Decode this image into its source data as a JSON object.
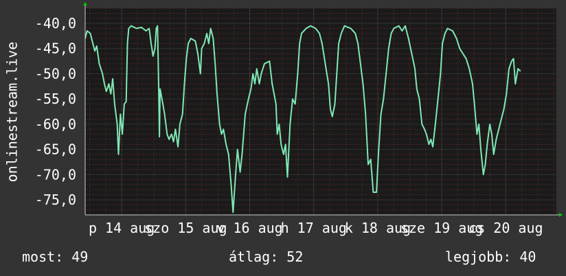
{
  "colors": {
    "background": "#333333",
    "plot_background": "#1a1a1a",
    "grid_major": "#4a4a4a",
    "grid_minor": "#6b2a2a",
    "line": "#7fe8b4",
    "axis_arrow": "#00cc00",
    "text": "#ffffff"
  },
  "chart_data": {
    "type": "line",
    "ylabel": "onlinestream.live",
    "ylim": [
      -78,
      -37
    ],
    "yticks": [
      {
        "value": -40,
        "label": "-40,0"
      },
      {
        "value": -45,
        "label": "-45,0"
      },
      {
        "value": -50,
        "label": "-50,0"
      },
      {
        "value": -55,
        "label": "-55,0"
      },
      {
        "value": -60,
        "label": "-60,0"
      },
      {
        "value": -65,
        "label": "-65,0"
      },
      {
        "value": -70,
        "label": "-70,0"
      },
      {
        "value": -75,
        "label": "-75,0"
      }
    ],
    "xlim": [
      0,
      7.36
    ],
    "xticks": [
      {
        "value": 0.57,
        "label": "p 14 aug"
      },
      {
        "value": 1.57,
        "label": "szo 15 aug"
      },
      {
        "value": 2.57,
        "label": "v 16 aug"
      },
      {
        "value": 3.57,
        "label": "h 17 aug"
      },
      {
        "value": 4.57,
        "label": "k 18 aug"
      },
      {
        "value": 5.57,
        "label": "sze 19 aug"
      },
      {
        "value": 6.57,
        "label": "cs 20 aug"
      }
    ],
    "series": [
      {
        "values": [
          [
            0.0,
            -43
          ],
          [
            0.03,
            -41.5
          ],
          [
            0.08,
            -42
          ],
          [
            0.12,
            -44
          ],
          [
            0.15,
            -45.5
          ],
          [
            0.18,
            -44.5
          ],
          [
            0.22,
            -48
          ],
          [
            0.27,
            -50
          ],
          [
            0.3,
            -52
          ],
          [
            0.33,
            -53.5
          ],
          [
            0.37,
            -52
          ],
          [
            0.4,
            -54
          ],
          [
            0.43,
            -51
          ],
          [
            0.46,
            -56
          ],
          [
            0.5,
            -60
          ],
          [
            0.52,
            -66
          ],
          [
            0.55,
            -58
          ],
          [
            0.58,
            -62
          ],
          [
            0.61,
            -56
          ],
          [
            0.64,
            -55.5
          ],
          [
            0.66,
            -44
          ],
          [
            0.68,
            -41
          ],
          [
            0.72,
            -40.5
          ],
          [
            0.8,
            -41
          ],
          [
            0.88,
            -40.8
          ],
          [
            0.95,
            -41.5
          ],
          [
            1.0,
            -41
          ],
          [
            1.03,
            -44
          ],
          [
            1.06,
            -46.5
          ],
          [
            1.09,
            -45
          ],
          [
            1.11,
            -41
          ],
          [
            1.13,
            -40.5
          ],
          [
            1.15,
            -54
          ],
          [
            1.16,
            -62.5
          ],
          [
            1.17,
            -53
          ],
          [
            1.2,
            -55
          ],
          [
            1.24,
            -58
          ],
          [
            1.28,
            -62
          ],
          [
            1.31,
            -63
          ],
          [
            1.35,
            -62
          ],
          [
            1.38,
            -63.5
          ],
          [
            1.41,
            -61
          ],
          [
            1.45,
            -64.5
          ],
          [
            1.48,
            -60
          ],
          [
            1.52,
            -58
          ],
          [
            1.55,
            -52
          ],
          [
            1.58,
            -47
          ],
          [
            1.61,
            -44
          ],
          [
            1.65,
            -43
          ],
          [
            1.72,
            -43.5
          ],
          [
            1.76,
            -46
          ],
          [
            1.8,
            -50
          ],
          [
            1.82,
            -45
          ],
          [
            1.86,
            -44
          ],
          [
            1.9,
            -42
          ],
          [
            1.93,
            -44
          ],
          [
            1.96,
            -41
          ],
          [
            2.0,
            -43
          ],
          [
            2.03,
            -48
          ],
          [
            2.06,
            -54
          ],
          [
            2.1,
            -60
          ],
          [
            2.13,
            -62
          ],
          [
            2.16,
            -61
          ],
          [
            2.2,
            -64
          ],
          [
            2.24,
            -66
          ],
          [
            2.28,
            -72
          ],
          [
            2.31,
            -77.5
          ],
          [
            2.35,
            -70
          ],
          [
            2.38,
            -65
          ],
          [
            2.42,
            -69.5
          ],
          [
            2.45,
            -66
          ],
          [
            2.5,
            -58
          ],
          [
            2.55,
            -55
          ],
          [
            2.59,
            -53
          ],
          [
            2.62,
            -50
          ],
          [
            2.65,
            -52
          ],
          [
            2.68,
            -49
          ],
          [
            2.72,
            -52
          ],
          [
            2.75,
            -50
          ],
          [
            2.8,
            -48
          ],
          [
            2.88,
            -47.5
          ],
          [
            2.92,
            -52
          ],
          [
            2.95,
            -54
          ],
          [
            2.98,
            -56
          ],
          [
            3.0,
            -62
          ],
          [
            3.03,
            -60
          ],
          [
            3.06,
            -64
          ],
          [
            3.1,
            -66
          ],
          [
            3.13,
            -64
          ],
          [
            3.16,
            -70.5
          ],
          [
            3.2,
            -60
          ],
          [
            3.24,
            -55
          ],
          [
            3.28,
            -56
          ],
          [
            3.32,
            -50
          ],
          [
            3.35,
            -44
          ],
          [
            3.38,
            -42
          ],
          [
            3.45,
            -41
          ],
          [
            3.52,
            -40.5
          ],
          [
            3.6,
            -41
          ],
          [
            3.66,
            -42
          ],
          [
            3.7,
            -44
          ],
          [
            3.75,
            -48
          ],
          [
            3.8,
            -52
          ],
          [
            3.83,
            -57
          ],
          [
            3.86,
            -58.5
          ],
          [
            3.9,
            -56
          ],
          [
            3.93,
            -50
          ],
          [
            3.96,
            -44
          ],
          [
            4.0,
            -42
          ],
          [
            4.05,
            -40.5
          ],
          [
            4.15,
            -41
          ],
          [
            4.22,
            -42
          ],
          [
            4.26,
            -44
          ],
          [
            4.3,
            -48
          ],
          [
            4.34,
            -52
          ],
          [
            4.38,
            -58
          ],
          [
            4.42,
            -68
          ],
          [
            4.46,
            -67
          ],
          [
            4.5,
            -73.5
          ],
          [
            4.55,
            -73.5
          ],
          [
            4.58,
            -66
          ],
          [
            4.62,
            -58
          ],
          [
            4.66,
            -55
          ],
          [
            4.7,
            -50
          ],
          [
            4.74,
            -45
          ],
          [
            4.78,
            -42
          ],
          [
            4.82,
            -41
          ],
          [
            4.9,
            -40.5
          ],
          [
            4.95,
            -41.5
          ],
          [
            5.0,
            -40.5
          ],
          [
            5.05,
            -43
          ],
          [
            5.1,
            -46
          ],
          [
            5.15,
            -49
          ],
          [
            5.18,
            -53
          ],
          [
            5.22,
            -55
          ],
          [
            5.26,
            -60
          ],
          [
            5.3,
            -61
          ],
          [
            5.33,
            -62
          ],
          [
            5.37,
            -64
          ],
          [
            5.4,
            -63
          ],
          [
            5.43,
            -64.5
          ],
          [
            5.47,
            -60
          ],
          [
            5.51,
            -55
          ],
          [
            5.55,
            -50
          ],
          [
            5.58,
            -44
          ],
          [
            5.62,
            -42
          ],
          [
            5.66,
            -41
          ],
          [
            5.74,
            -41.5
          ],
          [
            5.8,
            -43
          ],
          [
            5.85,
            -45
          ],
          [
            5.9,
            -46
          ],
          [
            5.95,
            -47
          ],
          [
            6.0,
            -49
          ],
          [
            6.05,
            -52
          ],
          [
            6.08,
            -56
          ],
          [
            6.12,
            -62
          ],
          [
            6.15,
            -60
          ],
          [
            6.18,
            -65
          ],
          [
            6.22,
            -70
          ],
          [
            6.25,
            -68
          ],
          [
            6.28,
            -64
          ],
          [
            6.32,
            -60
          ],
          [
            6.35,
            -62
          ],
          [
            6.38,
            -66
          ],
          [
            6.42,
            -63
          ],
          [
            6.46,
            -61
          ],
          [
            6.5,
            -59
          ],
          [
            6.54,
            -57
          ],
          [
            6.58,
            -54
          ],
          [
            6.62,
            -49
          ],
          [
            6.66,
            -47.5
          ],
          [
            6.69,
            -47
          ],
          [
            6.72,
            -52
          ],
          [
            6.76,
            -49
          ],
          [
            6.8,
            -49.5
          ]
        ]
      }
    ]
  },
  "stats": {
    "now": "most: 49",
    "average": "átlag: 52",
    "best": "legjobb: 40"
  }
}
